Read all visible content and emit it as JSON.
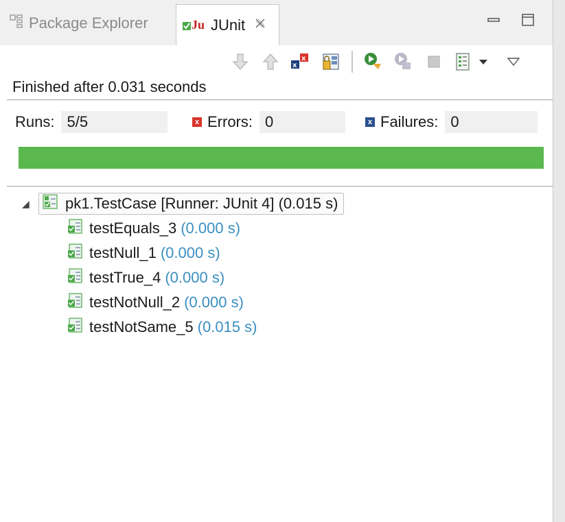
{
  "tabs": {
    "package_explorer": "Package Explorer",
    "junit": "JUnit",
    "close": "✘"
  },
  "window_buttons": {
    "minimize": "−",
    "maximize": "□"
  },
  "status_text": "Finished after 0.031 seconds",
  "counters": {
    "runs_label": "Runs:",
    "runs_value": "5/5",
    "errors_label": "Errors:",
    "errors_value": "0",
    "failures_label": "Failures:",
    "failures_value": "0"
  },
  "progress": {
    "fraction": 1.0,
    "color": "#5ab84f"
  },
  "tree": {
    "root": {
      "name": "pk1.TestCase [Runner: JUnit 4] (0.015 s)",
      "icon": "test-suite-passed-icon"
    },
    "items": [
      {
        "name": "testEquals_3",
        "time": "(0.000 s)",
        "icon": "test-passed-icon"
      },
      {
        "name": "testNull_1",
        "time": "(0.000 s)",
        "icon": "test-passed-icon"
      },
      {
        "name": "testTrue_4",
        "time": "(0.000 s)",
        "icon": "test-passed-icon"
      },
      {
        "name": "testNotNull_2",
        "time": "(0.000 s)",
        "icon": "test-passed-icon"
      },
      {
        "name": "testNotSame_5",
        "time": "(0.015 s)",
        "icon": "test-passed-icon"
      }
    ]
  },
  "colors": {
    "pass_green": "#5ab84f",
    "time_blue": "#3a8fc0",
    "error_red": "#d9332b",
    "failure_blue": "#2c4f8f"
  }
}
